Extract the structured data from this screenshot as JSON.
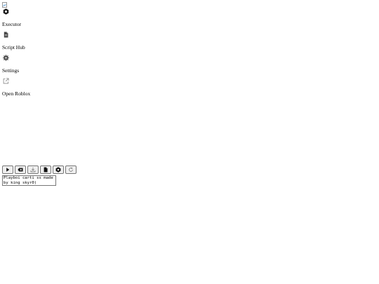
{
  "sidebar": {
    "items": [
      {
        "label": "Executor",
        "icon": "hexagon-icon"
      },
      {
        "label": "Script Hub",
        "icon": "file-icon"
      },
      {
        "label": "Settings",
        "icon": "gear-icon"
      },
      {
        "label": "Open Roblox",
        "icon": "external-link-icon"
      }
    ]
  },
  "toolbar": {
    "buttons": [
      {
        "name": "execute-button",
        "icon": "play-icon"
      },
      {
        "name": "clear-button",
        "icon": "backspace-icon"
      },
      {
        "name": "save-button",
        "icon": "download-icon"
      },
      {
        "name": "open-file-button",
        "icon": "file-icon"
      },
      {
        "name": "inject-button",
        "icon": "hexagon-icon"
      },
      {
        "name": "refresh-button",
        "icon": "refresh-icon"
      }
    ]
  },
  "editor": {
    "value": "Playboi carti ss made by king skyr0)"
  }
}
